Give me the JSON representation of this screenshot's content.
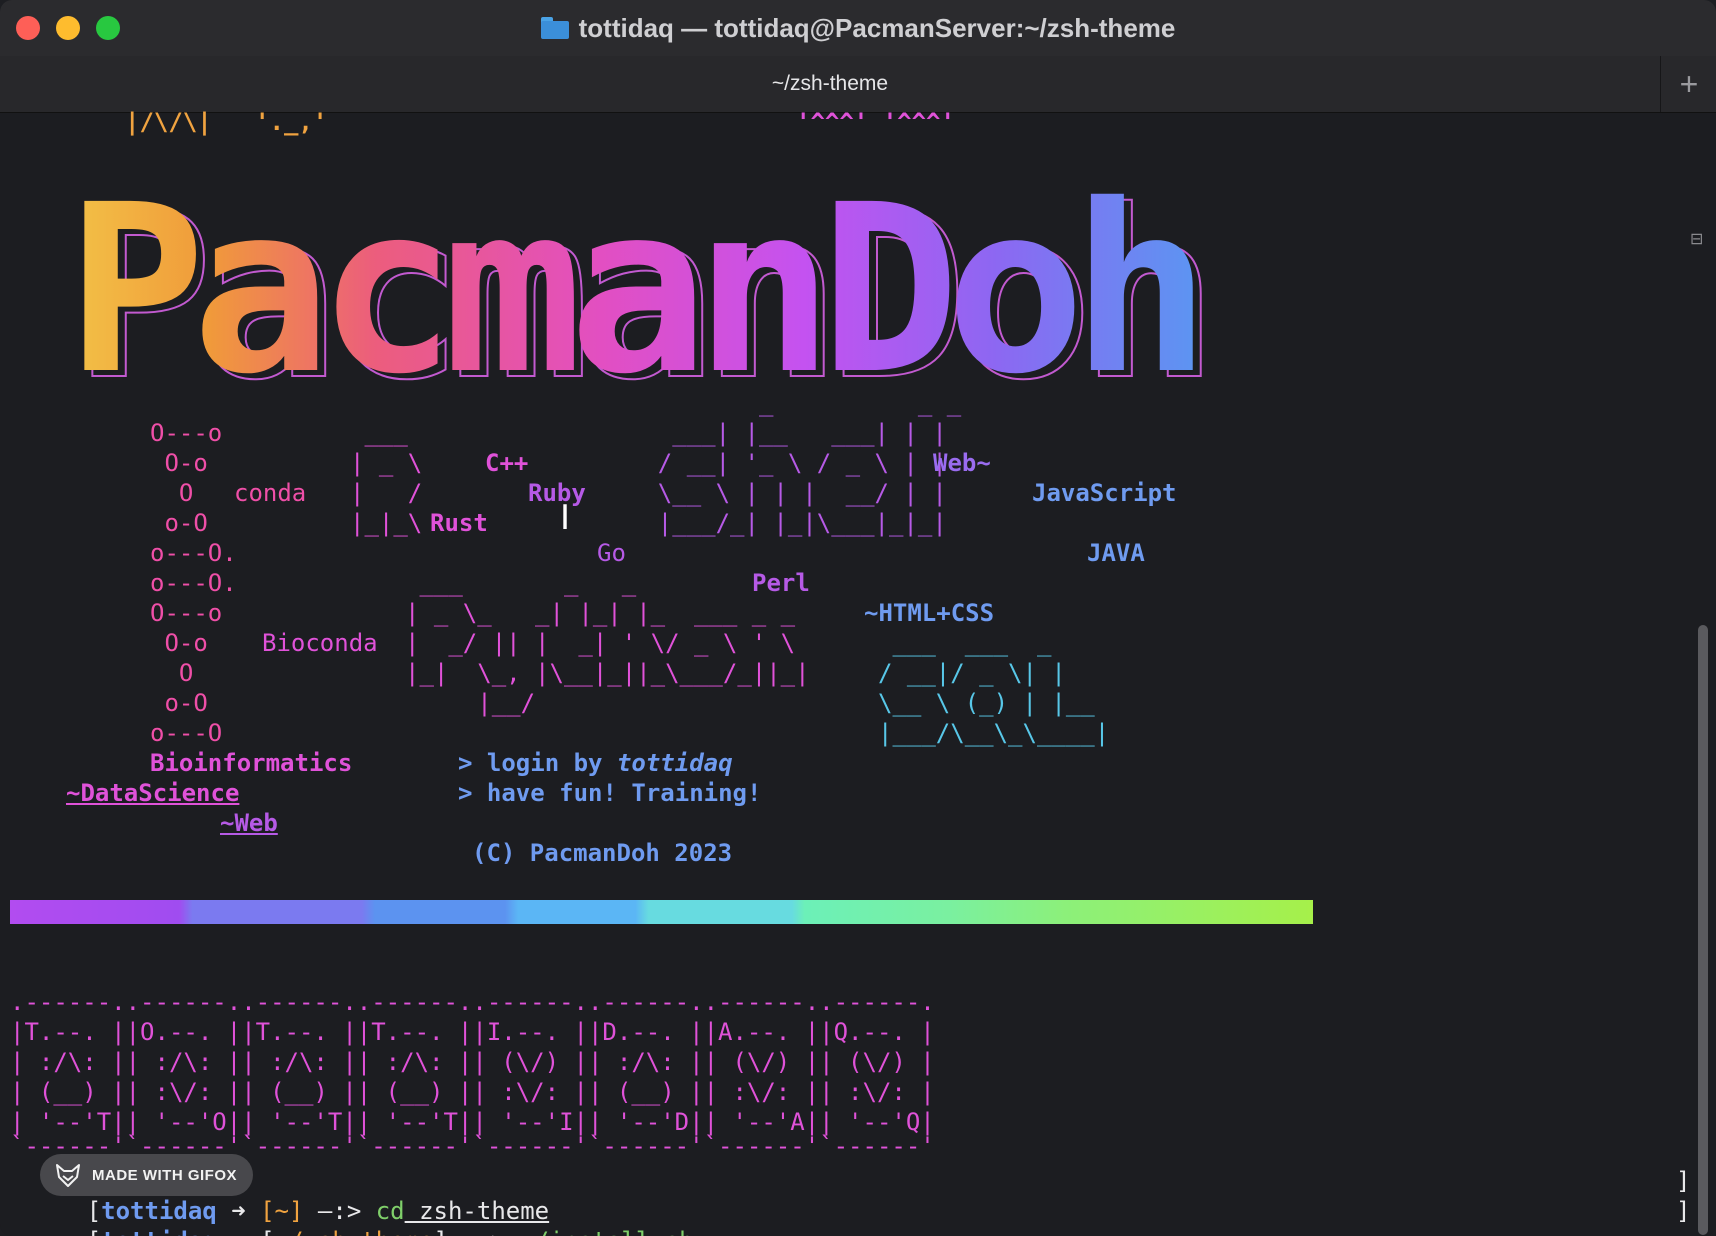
{
  "window": {
    "title": "tottidaq — tottidaq@PacmanServer:~/zsh-theme",
    "tab_label": "~/zsh-theme",
    "new_tab_label": "+"
  },
  "top_fragments": {
    "left": "|/\\/\\|   '._,'",
    "right": "'^^^' '^^^'"
  },
  "logo_text": "PacmanDoh",
  "left_column": [
    "O---o",
    " O-o",
    "  O",
    " o-O",
    "o---O.",
    "o---O.",
    "O---o",
    " O-o",
    "  O",
    " o-O",
    "o---O"
  ],
  "labels": {
    "conda": "conda",
    "bioconda": "Bioconda",
    "bioinformatics": "Bioinformatics",
    "datascience": "~DataScience",
    "web_sub": "~Web",
    "cpp": "C++",
    "ruby": "Ruby",
    "rust": "Rust",
    "go": "Go",
    "perl": "Perl",
    "web": "Web~",
    "javascript": "JavaScript",
    "java": "JAVA",
    "html_css": "~HTML+CSS"
  },
  "ascii_r": [
    " ___",
    "| _ \\",
    "|   /",
    "|_|_\\"
  ],
  "ascii_shell": [
    "           _          _ _",
    "     ___| |__   ___| | |",
    "    / __| '_ \\ / _ \\ | |",
    "    \\__ \\ | | |  __/ | |",
    "    |___/_| |_|\\___|_|_|"
  ],
  "ascii_python": [
    " ___       _   _",
    "| _ \\_   _| |_| |_  ___ _ _",
    "|  _/ || |  _| ' \\/ _ \\ ' \\",
    "|_|  \\_, |\\__|_||_\\___/_||_|",
    "     |__/"
  ],
  "ascii_sql": [
    " ___  ___  _",
    "/ __|/ _ \\| |",
    "\\__ \\ (_) | |__",
    "|___/\\__\\_\\____|"
  ],
  "messages": {
    "login_prefix": "> login by ",
    "login_user": "tottidaq",
    "fun": "> have fun! Training!",
    "copyright": "(C) PacmanDoh 2023"
  },
  "cards": [
    ".------..------..------..------..------..------..------..------.",
    "|T.--. ||O.--. ||T.--. ||T.--. ||I.--. ||D.--. ||A.--. ||Q.--. |",
    "| :/\\: || :/\\: || :/\\: || :/\\: || (\\/) || :/\\: || (\\/) || (\\/) |",
    "| (__) || :\\/: || (__) || (__) || :\\/: || (__) || :\\/: || :\\/: |",
    "| '--'T|| '--'O|| '--'T|| '--'T|| '--'I|| '--'D|| '--'A|| '--'Q|",
    "`------'`------'`------'`------'`------'`------'`------'`------'"
  ],
  "prompts": [
    {
      "open": "[",
      "user": "tottidaq",
      "arrow": " ➜ ",
      "dir": "[~]",
      "sep": " —:> ",
      "cmd": "cd",
      "arg": " zsh-theme",
      "close": "]"
    },
    {
      "open": "[",
      "user": "tottidaq",
      "arrow": " ➜ ",
      "dir": "[~/zsh-theme]",
      "sep": " —:> ",
      "cmd": "./install.sh",
      "arg": "",
      "close": "]"
    }
  ],
  "watermark": "MADE WITH GIFOX",
  "colors": {
    "background": "#1c1d21",
    "magenta": "#e052d9",
    "purple": "#b65ae6",
    "blue": "#6f9bf0",
    "cyan": "#58c7e8"
  }
}
